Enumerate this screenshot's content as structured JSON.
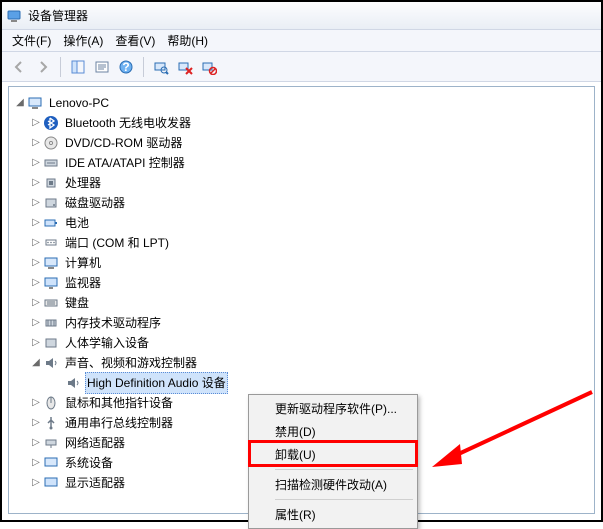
{
  "window": {
    "title": "设备管理器"
  },
  "menu": {
    "file": "文件(F)",
    "action": "操作(A)",
    "view": "查看(V)",
    "help": "帮助(H)"
  },
  "tree": {
    "root": "Lenovo-PC",
    "items": [
      {
        "label": "Bluetooth 无线电收发器"
      },
      {
        "label": "DVD/CD-ROM 驱动器"
      },
      {
        "label": "IDE ATA/ATAPI 控制器"
      },
      {
        "label": "处理器"
      },
      {
        "label": "磁盘驱动器"
      },
      {
        "label": "电池"
      },
      {
        "label": "端口 (COM 和 LPT)"
      },
      {
        "label": "计算机"
      },
      {
        "label": "监视器"
      },
      {
        "label": "键盘"
      },
      {
        "label": "内存技术驱动程序"
      },
      {
        "label": "人体学输入设备"
      },
      {
        "label": "声音、视频和游戏控制器"
      },
      {
        "label": "High Definition Audio 设备"
      },
      {
        "label": "鼠标和其他指针设备"
      },
      {
        "label": "通用串行总线控制器"
      },
      {
        "label": "网络适配器"
      },
      {
        "label": "系统设备"
      },
      {
        "label": "显示适配器"
      }
    ]
  },
  "context_menu": {
    "update": "更新驱动程序软件(P)...",
    "disable": "禁用(D)",
    "uninstall": "卸载(U)",
    "scan": "扫描检测硬件改动(A)",
    "properties": "属性(R)"
  },
  "annotation": {
    "highlight_item": "uninstall"
  }
}
